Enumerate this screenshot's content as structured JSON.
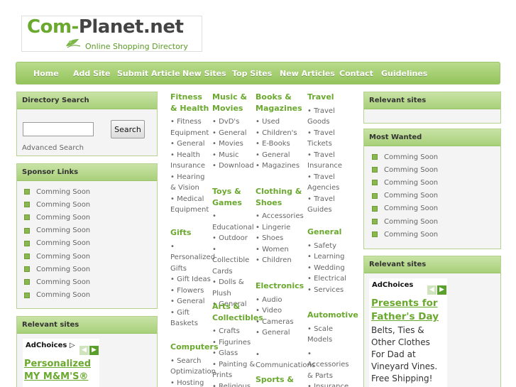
{
  "logo": {
    "name_part1": "Com",
    "name_part2": "Planet.net",
    "tagline": "Online Shopping Directory"
  },
  "nav": {
    "items": [
      "Home",
      "Add Site",
      "Submit Article",
      "New Sites",
      "Top Sites",
      "New Articles",
      "Contact",
      "Guidelines"
    ]
  },
  "directory_search": {
    "title": "Directory Search",
    "button": "Search",
    "input_value": "",
    "advanced": "Advanced Search"
  },
  "sponsor_links": {
    "title": "Sponsor Links",
    "items": [
      "Comming Soon",
      "Comming Soon",
      "Comming Soon",
      "Comming Soon",
      "Comming Soon",
      "Comming Soon",
      "Comming Soon",
      "Comming Soon",
      "Comming Soon"
    ]
  },
  "left_relevant": {
    "title": "Relevant sites",
    "ad_choices": "AdChoices",
    "ad_title": "Personalized MY M&M'S®"
  },
  "right_relevant_top": {
    "title": "Relevant sites"
  },
  "most_wanted": {
    "title": "Most Wanted",
    "items": [
      "Comming Soon",
      "Comming Soon",
      "Comming Soon",
      "Comming Soon",
      "Comming Soon",
      "Comming Soon",
      "Comming Soon"
    ]
  },
  "right_relevant_bottom": {
    "title": "Relevant sites",
    "ad_choices": "AdChoices",
    "ad_title": "Presents for Father's Day",
    "ad_body": "Belts, Ties & Other Clothes For Dad at Vineyard Vines. Free Shipping!"
  },
  "categories": {
    "fitness": {
      "title": "Fitness & Health",
      "items": [
        "• Fitness Equipment",
        "• General",
        "• Health Insurance",
        "• Hearing & Vision",
        "• Medical Equipment"
      ]
    },
    "gifts": {
      "title": "Gifts",
      "items": [
        "• Personalized Gifts",
        "• Gift Ideas",
        "• Flowers",
        "• General",
        "• Gift Baskets"
      ]
    },
    "computers": {
      "title": "Computers",
      "items": [
        "• Search Optimization",
        "• Hosting"
      ]
    },
    "music": {
      "title": "Music & Movies",
      "items": [
        "• DvD's",
        "• General",
        "• Movies",
        "• Music",
        "• Download"
      ]
    },
    "toys": {
      "title": "Toys & Games",
      "items": [
        "• Educational",
        "• Outdoor",
        "• Collectible Cards",
        "• Dolls & Plush",
        "• General"
      ]
    },
    "arts": {
      "title": "Arts & Collectibles",
      "items": [
        "• Crafts",
        "• Figurines",
        "• Glass",
        "• Painting & Prints",
        "• Religious"
      ]
    },
    "books": {
      "title": "Books & Magazines",
      "items": [
        "• Used",
        "• Children's",
        "• E-Books",
        "• General",
        "• Magazines"
      ]
    },
    "clothing": {
      "title": "Clothing & Shoes",
      "items": [
        "• Accessories",
        "• Lingerie",
        "• Shoes",
        "• Women",
        "• Children"
      ]
    },
    "electronics": {
      "title": "Electronics",
      "items": [
        "• Audio",
        "• Video",
        "• Cameras",
        "• General",
        "• Communications"
      ]
    },
    "sports": {
      "title": "Sports &"
    },
    "travel": {
      "title": "Travel",
      "items": [
        "• Travel Goods",
        "• Travel Tickets",
        "• Travel Insurance",
        "• Travel Agencies",
        "• Travel Guides"
      ]
    },
    "general": {
      "title": "General",
      "items": [
        "• Safety",
        "• Learning",
        "• Wedding",
        "• Electrical",
        "• Services"
      ]
    },
    "automotive": {
      "title": "Automotive",
      "items": [
        "• Scale Models",
        "• Accessories & Parts",
        "• Insurance &"
      ]
    }
  },
  "colors": {
    "accent": "#6aa82e",
    "nav": "#a5cf6f",
    "ad_arrow": "#5aa02c"
  }
}
